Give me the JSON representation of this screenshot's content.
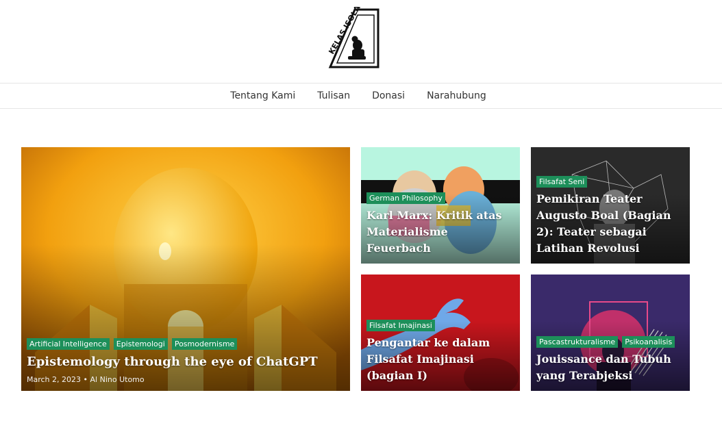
{
  "site": {
    "logo_text": "KELAS ISOLASI"
  },
  "nav": {
    "items": [
      "Tentang Kami",
      "Tulisan",
      "Donasi",
      "Narahubung"
    ]
  },
  "posts": {
    "featured": {
      "tags": [
        "Artificial Intelligence",
        "Epistemologi",
        "Posmodernisme"
      ],
      "title": "Epistemology through the eye of ChatGPT",
      "date": "March 2, 2023",
      "separator": "•",
      "author": "Al Nino Utomo"
    },
    "p1": {
      "tags": [
        "German Philosophy"
      ],
      "title": "Karl Marx: Kritik atas Materialisme Feuerbach"
    },
    "p2": {
      "tags": [
        "Filsafat Seni"
      ],
      "title": "Pemikiran Teater Augusto Boal (Bagian 2): Teater sebagai Latihan Revolusi"
    },
    "p3": {
      "tags": [
        "Filsafat Imajinasi"
      ],
      "title": "Pengantar ke dalam Filsafat Imajinasi (bagian I)"
    },
    "p4": {
      "tags": [
        "Pascastrukturalisme",
        "Psikoanalisis"
      ],
      "title": "Jouissance dan Tubuh yang Terabjeksi"
    }
  },
  "colors": {
    "tag_bg": "#1d8f5a",
    "featured_bg": "#f2a00f",
    "marx_bg": "#b8f5e0",
    "boal_bg": "#2a2a2a",
    "imajinasi_bg": "#c8161d",
    "jouissance_bg": "#3a2a6a"
  }
}
